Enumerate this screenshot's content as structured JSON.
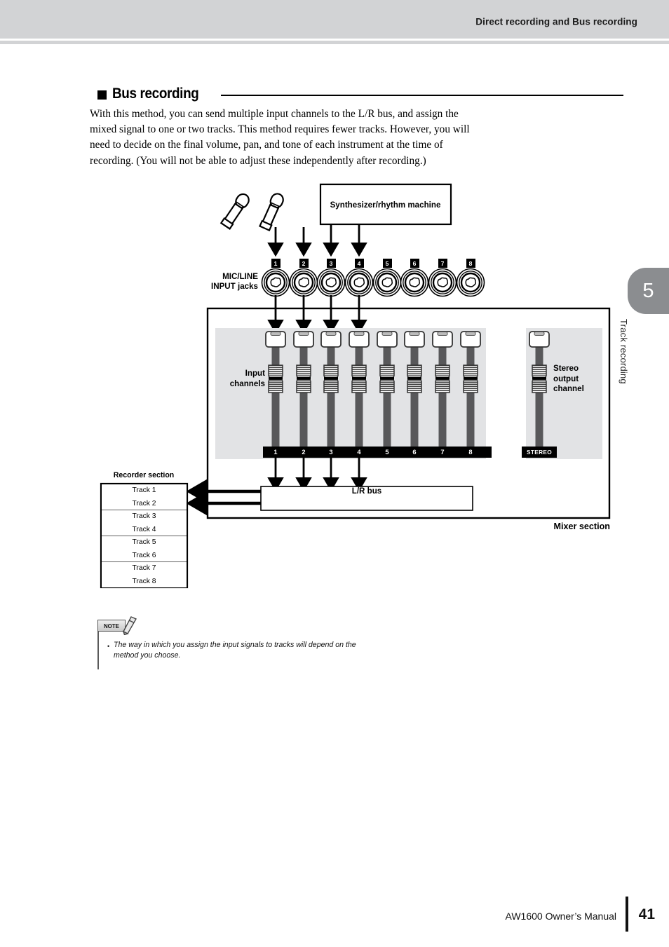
{
  "header": {
    "title": "Direct recording and Bus recording"
  },
  "chapter_tab": {
    "number": "5",
    "label": "Track recording"
  },
  "section": {
    "heading": "Bus recording",
    "paragraph": "With this method, you can send multiple input channels to the L/R bus, and assign the mixed signal to one or two tracks. This method requires fewer tracks. However, you will need to decide on the final volume, pan, and tone of each instrument at the time of recording. (You will not be able to adjust these independently after recording.)"
  },
  "diagram": {
    "synth_box_label": "Synthesizer/rhythm machine",
    "mic_line_label": "MIC/LINE\nINPUT jacks",
    "mic_line_label_line1": "MIC/LINE",
    "mic_line_label_line2": "INPUT jacks",
    "input_channels_label_line1": "Input",
    "input_channels_label_line2": "channels",
    "stereo_output_label_line1": "Stereo",
    "stereo_output_label_line2": "output",
    "stereo_output_label_line3": "channel",
    "lr_bus_label": "L/R bus",
    "mixer_section_label": "Mixer section",
    "recorder_section_label": "Recorder section",
    "jack_numbers": [
      "1",
      "2",
      "3",
      "4",
      "5",
      "6",
      "7",
      "8"
    ],
    "channel_numbers": [
      "1",
      "2",
      "3",
      "4",
      "5",
      "6",
      "7",
      "8"
    ],
    "stereo_channel_label": "STEREO",
    "tracks": [
      "Track 1",
      "Track 2",
      "Track 3",
      "Track 4",
      "Track 5",
      "Track 6",
      "Track 7",
      "Track 8"
    ],
    "connected_inputs": [
      1,
      2,
      3,
      4
    ],
    "bus_output_tracks": [
      "Track 1",
      "Track 2"
    ],
    "colors": {
      "mixer_panel_bg": "#e2e3e5",
      "fader_stem": "#58585a",
      "channel_strip_bg": "#000000",
      "header_band": "#d2d3d5",
      "chapter_tab": "#8b8d90"
    }
  },
  "note": {
    "tab_label": "NOTE",
    "bullet": "•",
    "text": "The way in which you assign the input signals to tracks will depend on the method you choose."
  },
  "footer": {
    "manual": "AW1600  Owner’s Manual",
    "page_number": "41"
  }
}
